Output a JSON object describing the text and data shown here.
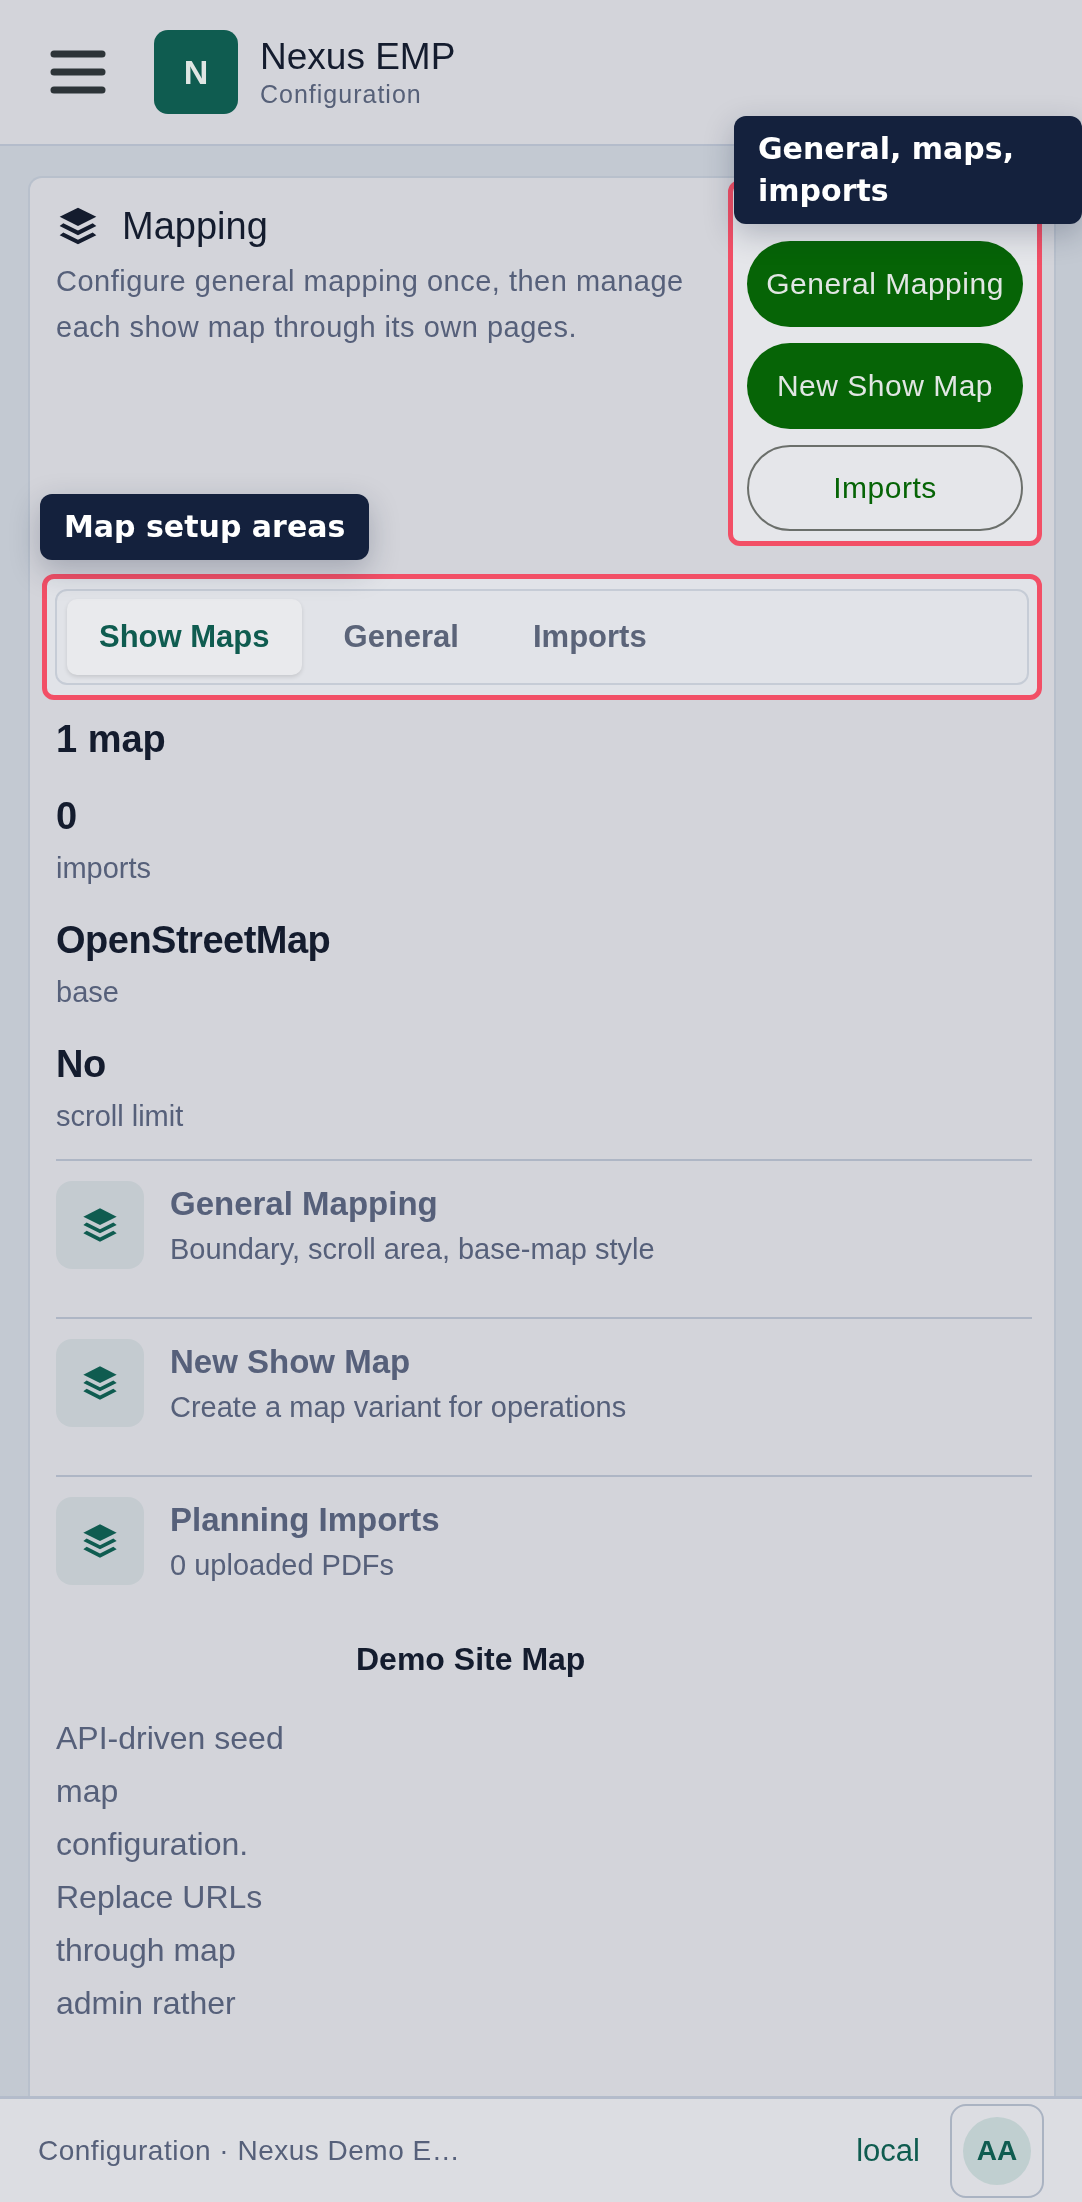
{
  "header": {
    "logo_letter": "N",
    "title": "Nexus EMP",
    "subtitle": "Configuration"
  },
  "section": {
    "title": "Mapping",
    "description": "Configure general mapping once, then manage each show map through its own pages."
  },
  "actions": [
    {
      "label": "General Mapping",
      "kind": "primary"
    },
    {
      "label": "New Show Map",
      "kind": "primary"
    },
    {
      "label": "Imports",
      "kind": "outline"
    }
  ],
  "tooltips": [
    {
      "text": "General, maps, imports"
    },
    {
      "text": "Map setup areas"
    }
  ],
  "tabs": [
    {
      "label": "Show Maps",
      "selected": true
    },
    {
      "label": "General",
      "selected": false
    },
    {
      "label": "Imports",
      "selected": false
    }
  ],
  "summary": "1 map",
  "stats": [
    {
      "value": "0",
      "label": "imports"
    },
    {
      "value": "OpenStreetMap",
      "label": "base"
    },
    {
      "value": "No",
      "label": "scroll limit"
    }
  ],
  "links": [
    {
      "title": "General Mapping",
      "subtitle": "Boundary, scroll area, base-map style"
    },
    {
      "title": "New Show Map",
      "subtitle": "Create a map variant for operations"
    },
    {
      "title": "Planning Imports",
      "subtitle": "0 uploaded PDFs"
    }
  ],
  "map_card": {
    "title": "Demo Site Map",
    "description": "API-driven seed map configuration. Replace URLs through map admin rather"
  },
  "footer": {
    "context": "Configuration · Nexus Demo E…",
    "environment": "local",
    "avatar": "AA"
  }
}
